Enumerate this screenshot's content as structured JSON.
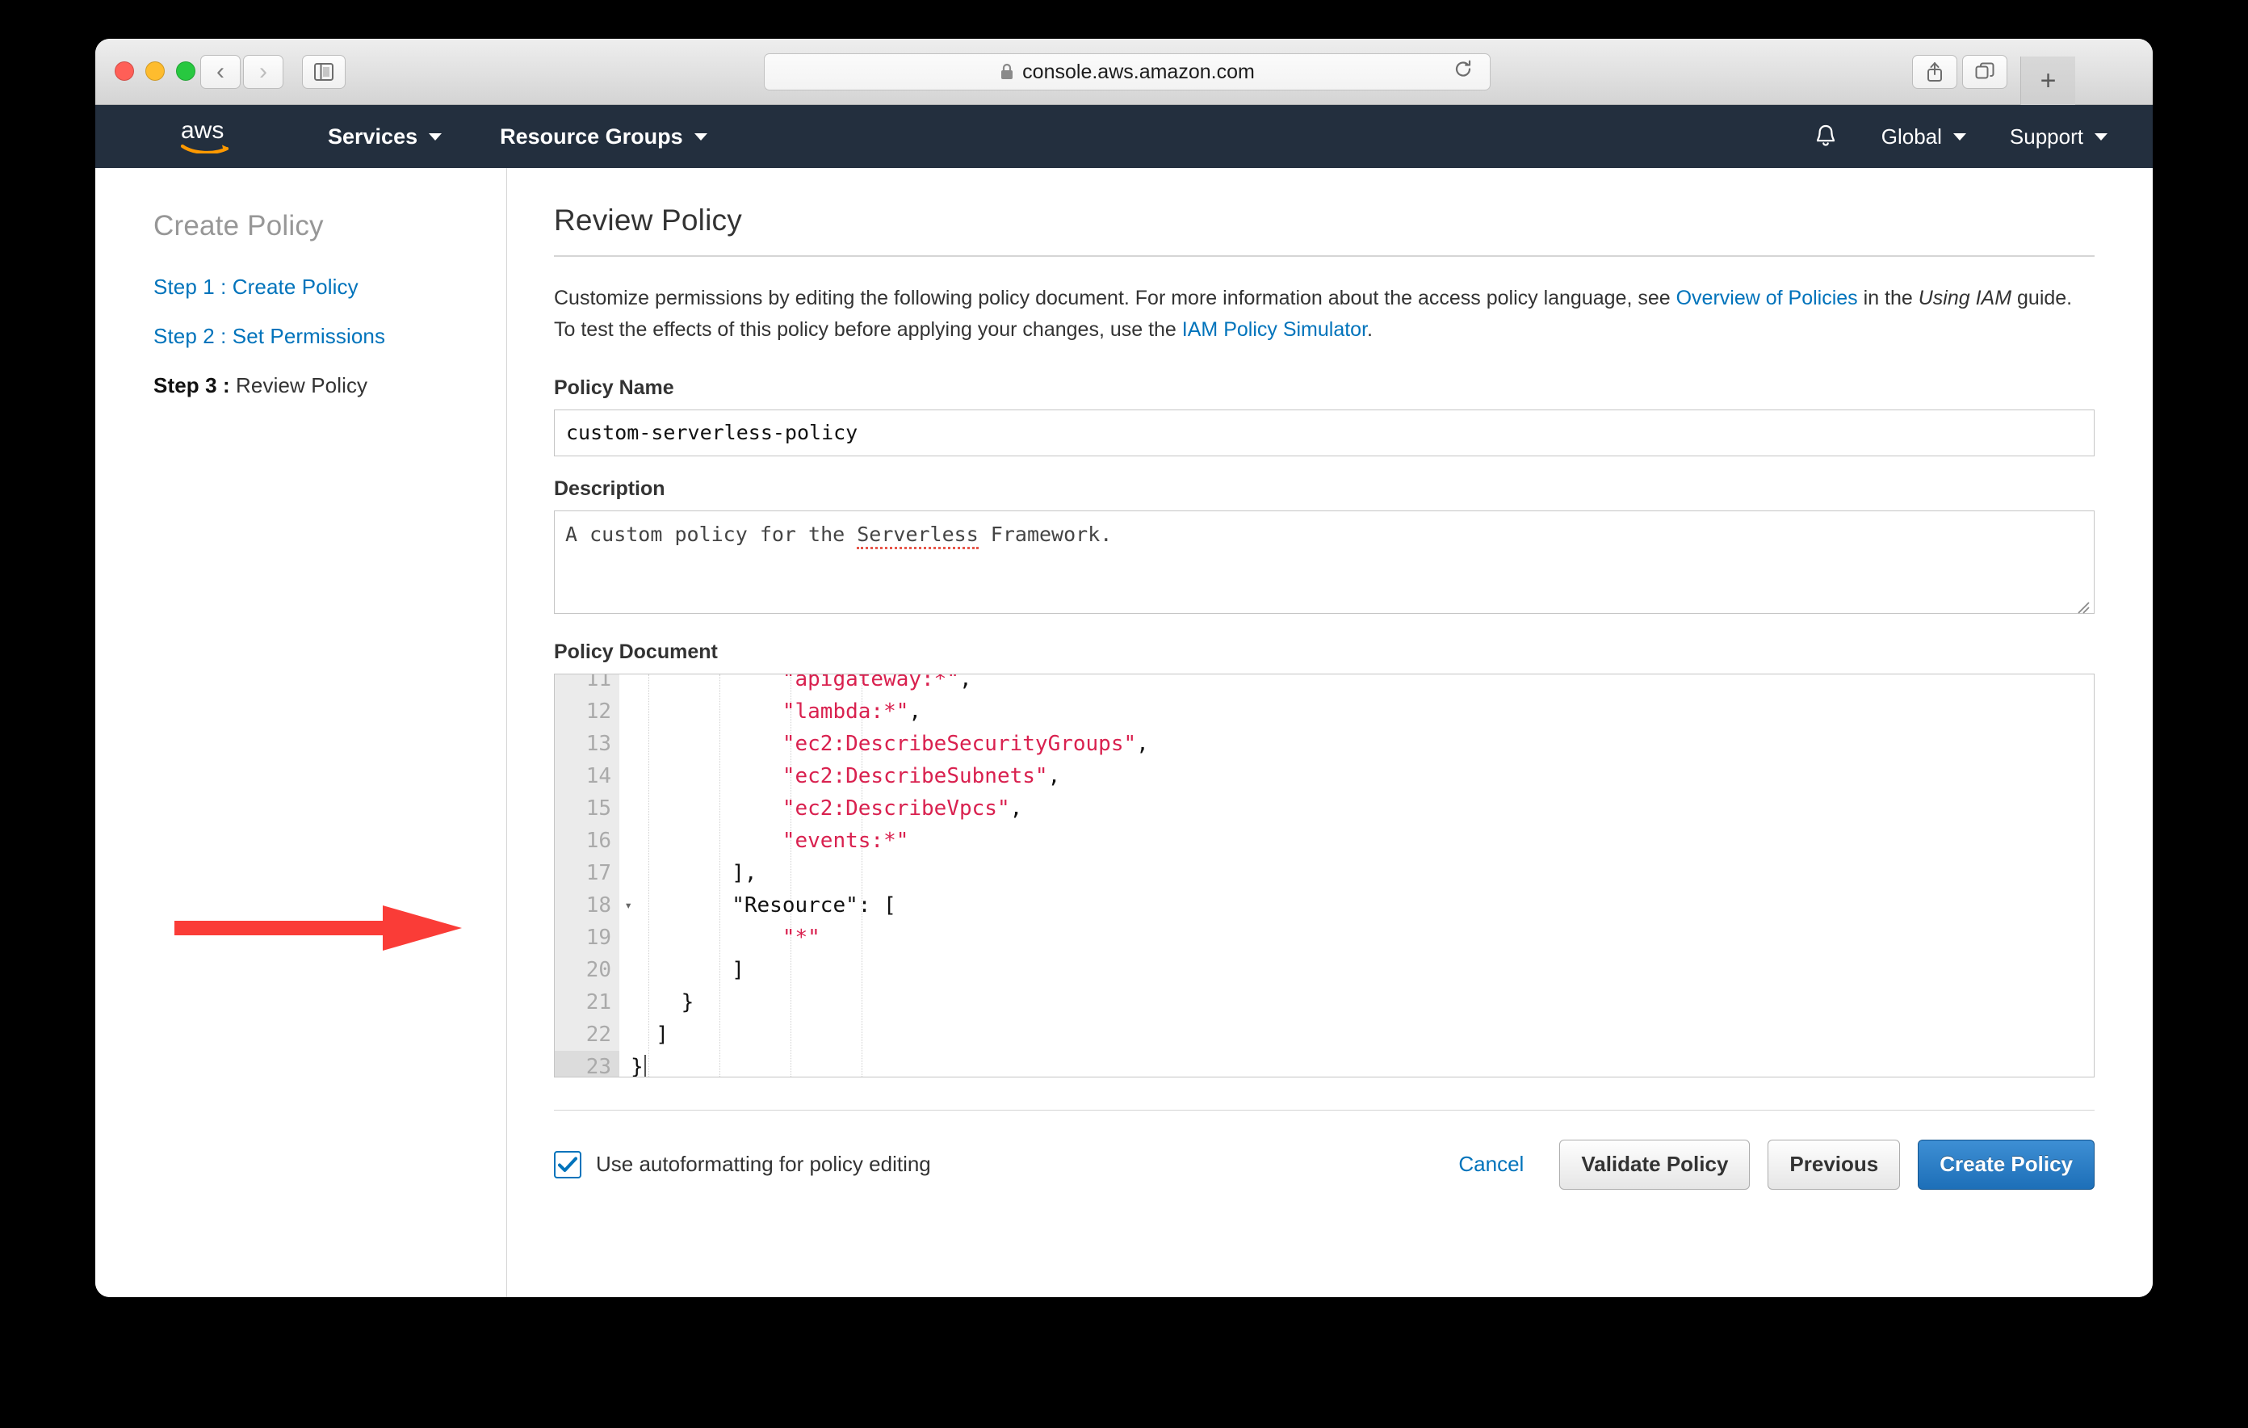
{
  "browser": {
    "url": "console.aws.amazon.com",
    "lock_icon": "lock-icon",
    "reload_icon": "reload-icon",
    "back_icon": "chevron-left-icon",
    "forward_icon": "chevron-right-icon",
    "sidebar_icon": "sidebar-panel-icon",
    "share_icon": "share-icon",
    "tabs_icon": "tab-overview-icon",
    "new_tab_label": "+"
  },
  "aws_nav": {
    "logo_alt": "aws",
    "services_label": "Services",
    "resource_groups_label": "Resource Groups",
    "bell_icon": "notification-bell-icon",
    "region_label": "Global",
    "support_label": "Support"
  },
  "sidebar": {
    "title": "Create Policy",
    "steps": [
      {
        "label": "Step 1 :",
        "name": "Create Policy",
        "current": false
      },
      {
        "label": "Step 2 :",
        "name": "Set Permissions",
        "current": false
      },
      {
        "label": "Step 3 :",
        "name": "Review Policy",
        "current": true
      }
    ]
  },
  "main": {
    "heading": "Review Policy",
    "intro": {
      "part1": "Customize permissions by editing the following policy document. For more information about the access policy language, see ",
      "link1": "Overview of Policies",
      "part2": " in the ",
      "italic1": "Using IAM",
      "part3": " guide. To test the effects of this policy before applying your changes, use the ",
      "link2": "IAM Policy Simulator",
      "part4": "."
    },
    "policy_name": {
      "label": "Policy Name",
      "value": "custom-serverless-policy"
    },
    "description": {
      "label": "Description",
      "value": "A custom policy for the Serverless Framework.",
      "prefix": "A custom policy for the ",
      "misspelled_word": "Serverless",
      "suffix": " Framework."
    },
    "policy_document": {
      "label": "Policy Document",
      "first_visible_line": 11,
      "active_line": 23,
      "lines": [
        {
          "n": "11",
          "indent": 0,
          "clipped": true,
          "segments": [
            {
              "t": "            ",
              "c": "plain"
            },
            {
              "t": "\"apigateway:*\"",
              "c": "str"
            },
            {
              "t": ",",
              "c": "plain"
            }
          ]
        },
        {
          "n": "12",
          "indent": 0,
          "segments": [
            {
              "t": "            ",
              "c": "plain"
            },
            {
              "t": "\"lambda:*\"",
              "c": "str"
            },
            {
              "t": ",",
              "c": "plain"
            }
          ]
        },
        {
          "n": "13",
          "indent": 0,
          "segments": [
            {
              "t": "            ",
              "c": "plain"
            },
            {
              "t": "\"ec2:DescribeSecurityGroups\"",
              "c": "str"
            },
            {
              "t": ",",
              "c": "plain"
            }
          ]
        },
        {
          "n": "14",
          "indent": 0,
          "segments": [
            {
              "t": "            ",
              "c": "plain"
            },
            {
              "t": "\"ec2:DescribeSubnets\"",
              "c": "str"
            },
            {
              "t": ",",
              "c": "plain"
            }
          ]
        },
        {
          "n": "15",
          "indent": 0,
          "segments": [
            {
              "t": "            ",
              "c": "plain"
            },
            {
              "t": "\"ec2:DescribeVpcs\"",
              "c": "str"
            },
            {
              "t": ",",
              "c": "plain"
            }
          ]
        },
        {
          "n": "16",
          "indent": 0,
          "segments": [
            {
              "t": "            ",
              "c": "plain"
            },
            {
              "t": "\"events:*\"",
              "c": "str"
            }
          ]
        },
        {
          "n": "17",
          "indent": 0,
          "segments": [
            {
              "t": "        ],",
              "c": "plain"
            }
          ]
        },
        {
          "n": "18",
          "indent": 0,
          "fold": true,
          "segments": [
            {
              "t": "        \"Resource\": [",
              "c": "plain"
            }
          ]
        },
        {
          "n": "19",
          "indent": 0,
          "segments": [
            {
              "t": "            ",
              "c": "plain"
            },
            {
              "t": "\"*\"",
              "c": "str"
            }
          ]
        },
        {
          "n": "20",
          "indent": 0,
          "segments": [
            {
              "t": "        ]",
              "c": "plain"
            }
          ]
        },
        {
          "n": "21",
          "indent": 0,
          "segments": [
            {
              "t": "    }",
              "c": "plain"
            }
          ]
        },
        {
          "n": "22",
          "indent": 0,
          "segments": [
            {
              "t": "  ]",
              "c": "plain"
            }
          ]
        },
        {
          "n": "23",
          "indent": 0,
          "active": true,
          "cursor": true,
          "segments": [
            {
              "t": "}",
              "c": "plain"
            }
          ]
        }
      ]
    },
    "bottom": {
      "autoformat_label": "Use autoformatting for policy editing",
      "autoformat_checked": true,
      "cancel_label": "Cancel",
      "validate_label": "Validate Policy",
      "previous_label": "Previous",
      "create_label": "Create Policy"
    }
  },
  "annotation": {
    "arrow_color": "#fa3c37",
    "points_to": "policy-document-editor"
  },
  "colors": {
    "aws_nav_bg": "#232f3e",
    "aws_orange": "#ff9900",
    "link_blue": "#0073bb",
    "primary_button": "#1d6fb8",
    "code_string": "#d9214f",
    "arrow_red": "#fa3c37"
  }
}
